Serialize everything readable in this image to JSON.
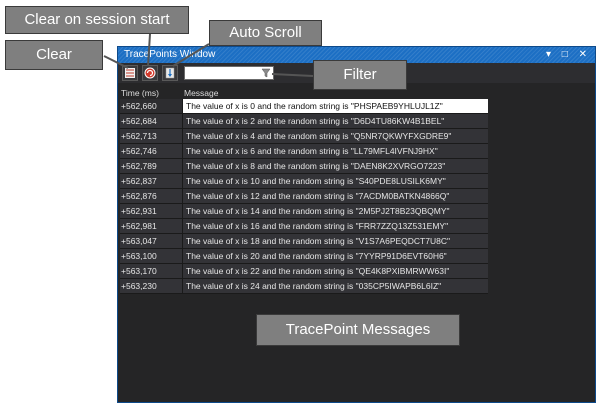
{
  "window": {
    "title": "TracePoints Window",
    "title_buttons": [
      "▾",
      "□",
      "✕"
    ]
  },
  "toolbar": {
    "clear_icon": "clear-list-icon",
    "clear_on_session_icon": "clear-on-session-icon",
    "auto_scroll_icon": "auto-scroll-icon",
    "filter_value": "",
    "filter_icon": "funnel-icon"
  },
  "table": {
    "headers": [
      "Time (ms)",
      "Message"
    ],
    "rows": [
      {
        "time": "+562,660",
        "message": "The value of x is 0 and the random string is \"PHSPAEB9YHLUJL1Z\""
      },
      {
        "time": "+562,684",
        "message": "The value of x is 2 and the random string is \"D6D4TU86KW4B1BEL\""
      },
      {
        "time": "+562,713",
        "message": "The value of x is 4 and the random string is \"Q5NR7QKWYFXGDRE9\""
      },
      {
        "time": "+562,746",
        "message": "The value of x is 6 and the random string is \"LL79MFL4IVFNJ9HX\""
      },
      {
        "time": "+562,789",
        "message": "The value of x is 8 and the random string is \"DAEN8K2XVRGO7223\""
      },
      {
        "time": "+562,837",
        "message": "The value of x is 10 and the random string is \"S40PDE8LUSILK6MY\""
      },
      {
        "time": "+562,876",
        "message": "The value of x is 12 and the random string is \"7ACDM0BATKN4866Q\""
      },
      {
        "time": "+562,931",
        "message": "The value of x is 14 and the random string is \"2M5PJ2T8B23QBQMY\""
      },
      {
        "time": "+562,981",
        "message": "The value of x is 16 and the random string is \"FRR7ZZQ13Z531EMY\""
      },
      {
        "time": "+563,047",
        "message": "The value of x is 18 and the random string is \"V1S7A6PEQDCT7U8C\""
      },
      {
        "time": "+563,100",
        "message": "The value of x is 20 and the random string is \"7YYRP91D6EVT60H6\""
      },
      {
        "time": "+563,170",
        "message": "The value of x is 22 and the random string is \"QE4K8PXIBMRWW63I\""
      },
      {
        "time": "+563,230",
        "message": "The value of x is 24 and the random string is \"035CP5IWAPB6L6IZ\""
      }
    ]
  },
  "callouts": {
    "clear_on_session": "Clear on session start",
    "auto_scroll": "Auto Scroll",
    "clear": "Clear",
    "filter": "Filter",
    "messages": "TracePoint Messages"
  },
  "colors": {
    "titlebar": "#1c6fc4",
    "window_bg": "#252526",
    "row_bg": "#333337",
    "callout_bg": "#7f7f7f"
  }
}
